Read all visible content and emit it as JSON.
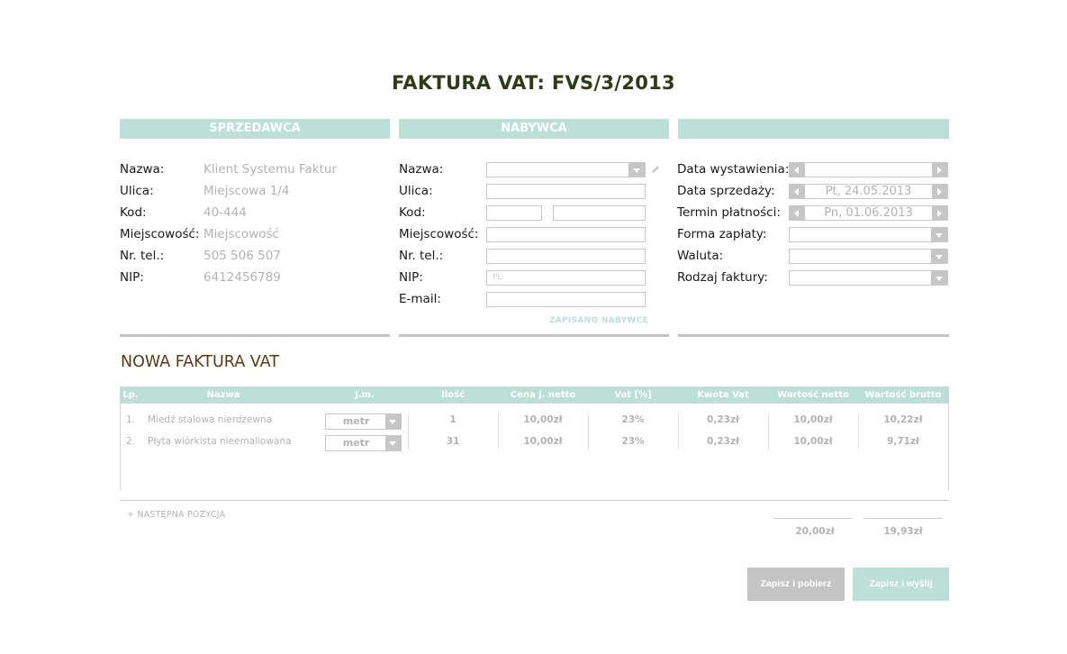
{
  "title": "FAKTURA VAT: FVS/3/2013",
  "columns": {
    "seller_header": "SPRZEDAWCA",
    "buyer_header": "NABYWCA",
    "details_header": ""
  },
  "seller": {
    "labels": [
      "Nazwa:",
      "Ulica:",
      "Kod:",
      "Miejscowość:",
      "Nr. tel.:",
      "NIP:"
    ],
    "values": [
      "Klient Systemu Faktur",
      "Miejscowa 1/4",
      "40-444",
      "Miejscowość",
      "505 506 507",
      "6412456789"
    ]
  },
  "buyer": {
    "labels": [
      "Nazwa:",
      "Ulica:",
      "Kod:",
      "Miejscowość:",
      "Nr. tel.:",
      "NIP:",
      "E-mail:"
    ],
    "nip_placeholder": "PL",
    "saved_note": "ZAPISANO NABYWCĘ"
  },
  "details": {
    "labels": [
      "Data wystawienia:",
      "Data sprzedaży:",
      "Termin płatności:",
      "Forma zapłaty:",
      "Waluta:",
      "Rodzaj faktury:"
    ],
    "issue_date": "",
    "sale_date": "Pt, 24.05.2013",
    "due_date": "Pn, 01.06.2013"
  },
  "section_title": "NOWA FAKTURA VAT",
  "table": {
    "headers": [
      "Lp.",
      "Nazwa",
      "J.m.",
      "Ilość",
      "Cena j. netto",
      "Vat [%]",
      "Kwota Vat",
      "Wartość netto",
      "Wartość brutto"
    ],
    "rows": [
      {
        "lp": "1.",
        "name": "Miedź stalowa nierdzewna",
        "unit": "metr",
        "qty": "1",
        "price": "10,00zł",
        "vat": "23%",
        "vat_amount": "0,23zł",
        "net": "10,00zł",
        "gross": "10,22zł"
      },
      {
        "lp": "2.",
        "name": "Płyta wiórkista nieemaliowana",
        "unit": "metr",
        "qty": "31",
        "price": "10,00zł",
        "vat": "23%",
        "vat_amount": "0,23zł",
        "net": "10,00zł",
        "gross": "9,71zł"
      }
    ],
    "add_position": "+ NASTĘPNA POZYCJA",
    "sum_net": "20,00zł",
    "sum_gross": "19,93zł"
  },
  "buttons": {
    "save_download": "Zapisz i pobierz",
    "save_send": "Zapisz i wyślij"
  },
  "colors": {
    "accent": "#bcdfd8",
    "title": "#2f3a17",
    "section_title": "#5a3a16",
    "muted": "#b3b3b3",
    "control": "#c6c6c6"
  }
}
